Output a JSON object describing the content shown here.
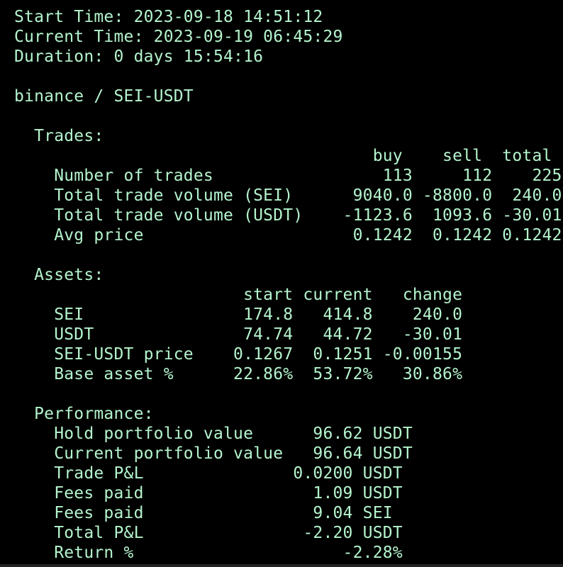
{
  "theme": {
    "background": "#000000",
    "foreground": "#b4f4cd"
  },
  "header": {
    "start_time": "Start Time: 2023-09-18 14:51:12",
    "current_time": "Current Time: 2023-09-19 06:45:29",
    "duration": "Duration: 0 days 15:54:16"
  },
  "market": {
    "line": "binance / SEI-USDT"
  },
  "trades": {
    "title": "  Trades:",
    "header": "                                    buy    sell  total",
    "rows": [
      "    Number of trades                 113     112    225",
      "    Total trade volume (SEI)      9040.0 -8800.0  240.0",
      "    Total trade volume (USDT)    -1123.6  1093.6 -30.01",
      "    Avg price                     0.1242  0.1242 0.1242"
    ]
  },
  "assets": {
    "title": "  Assets:",
    "header": "                       start current   change",
    "rows": [
      "    SEI                174.8   414.8    240.0",
      "    USDT               74.74   44.72   -30.01",
      "    SEI-USDT price    0.1267  0.1251 -0.00155",
      "    Base asset %      22.86%  53.72%   30.86%"
    ]
  },
  "performance": {
    "title": "  Performance:",
    "rows": [
      "    Hold portfolio value      96.62 USDT",
      "    Current portfolio value   96.64 USDT",
      "    Trade P&L               0.0200 USDT",
      "    Fees paid                 1.09 USDT",
      "    Fees paid                 9.04 SEI",
      "    Total P&L                -2.20 USDT",
      "    Return %                     -2.28%"
    ]
  }
}
